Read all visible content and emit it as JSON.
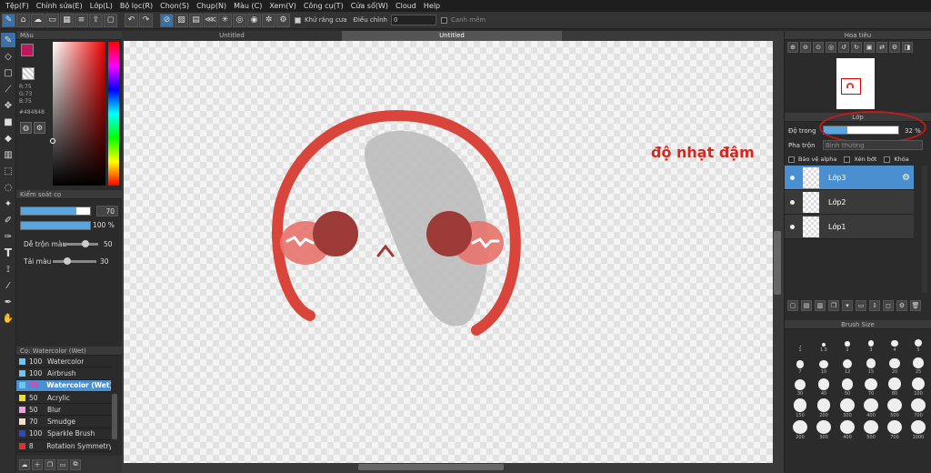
{
  "menu": [
    "Tệp(F)",
    "Chỉnh sửa(E)",
    "Lớp(L)",
    "Bộ lọc(R)",
    "Chọn(S)",
    "Chụp(N)",
    "Màu (C)",
    "Xem(V)",
    "Công cụ(T)",
    "Cửa sổ(W)",
    "Cloud",
    "Help"
  ],
  "toolbar": {
    "antialias_label": "Khử răng cưa",
    "correction_label": "Điều chỉnh",
    "correction_value": "0",
    "snap_label": "Canh mềm"
  },
  "tabs": {
    "left": "Untitled",
    "right": "Untitled"
  },
  "color_panel": {
    "title": "Màu",
    "r": "R:75",
    "g": "G:73",
    "b": "B:75",
    "hex": "#484848",
    "fg_color": "#c0175e",
    "bg_color": "#ffffff"
  },
  "brush_control": {
    "title": "Kiểm soát cọ",
    "size_value": "70",
    "opacity_value": "100 %",
    "mix_label": "Dễ trộn màu",
    "mix_value": "50",
    "reload_label": "Tải màu",
    "reload_value": "30"
  },
  "brush_list": {
    "title": "Cọ: Watercolor (Wet)",
    "items": [
      {
        "num": "100",
        "name": "Watercolor",
        "color": "#6ec6f0"
      },
      {
        "num": "100",
        "name": "Airbrush",
        "color": "#6ec6f0"
      },
      {
        "num": "70",
        "name": "Watercolor (Wet)",
        "color": "#6ec6f0"
      },
      {
        "num": "50",
        "name": "Acrylic",
        "color": "#e8e030"
      },
      {
        "num": "50",
        "name": "Blur",
        "color": "#f0a0e0"
      },
      {
        "num": "70",
        "name": "Smudge",
        "color": "#f6e0c8"
      },
      {
        "num": "100",
        "name": "Sparkle Brush",
        "color": "#2a48d0"
      },
      {
        "num": "8",
        "name": "Rotation Symmetry",
        "color": "#e03030"
      }
    ]
  },
  "navigator": {
    "title": "Hoa tiêu"
  },
  "layer_panel": {
    "title": "Lớp",
    "opacity_label": "Độ trong",
    "opacity_value": "32 %",
    "opacity_fraction": 0.32,
    "blend_label": "Pha trộn",
    "blend_value": "Bình thường",
    "protect_alpha": "Bảo vệ alpha",
    "clipping": "Xén bớt",
    "lock": "Khóa",
    "layers": [
      "Lớp3",
      "Lớp2",
      "Lớp1"
    ]
  },
  "annotation": "độ nhạt đậm",
  "brush_size": {
    "title": "Brush Size",
    "sizes": [
      "1",
      "1.5",
      "2",
      "3",
      "4",
      "5",
      "7",
      "10",
      "12",
      "15",
      "20",
      "25",
      "30",
      "40",
      "50",
      "70",
      "80",
      "100",
      "150",
      "200",
      "300",
      "400",
      "500",
      "700",
      "200",
      "300",
      "400",
      "500",
      "700",
      "1000"
    ]
  },
  "drawing_colors": {
    "red": "#d9453b",
    "cheek": "#e8736b",
    "eye": "#9b3a36",
    "gray": "#bdbdbd"
  }
}
